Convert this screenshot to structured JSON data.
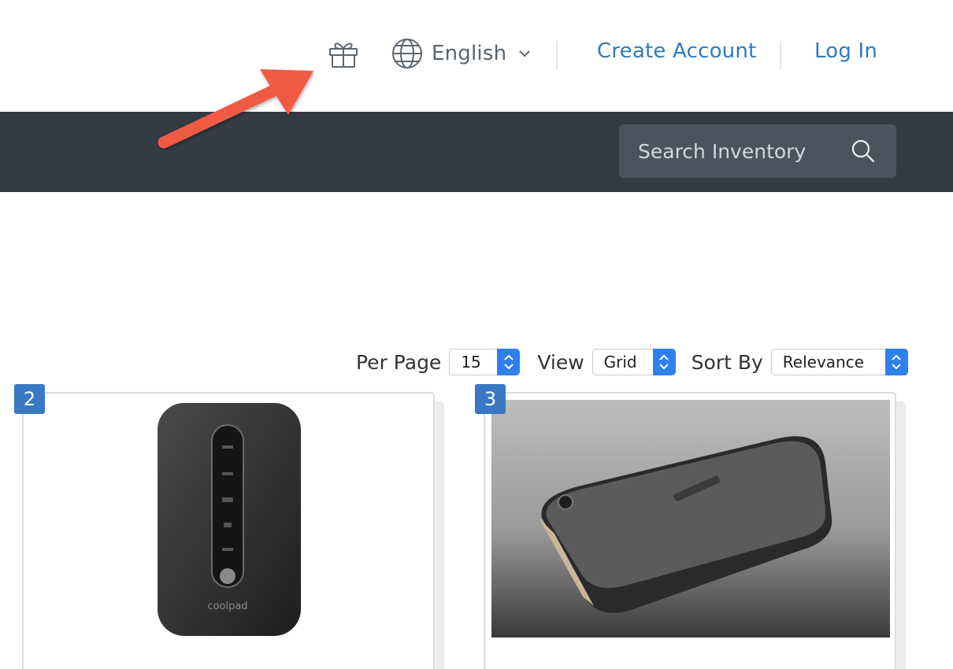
{
  "header": {
    "language_label": "English",
    "create_account_label": "Create Account",
    "login_label": "Log In"
  },
  "search": {
    "placeholder": "Search Inventory"
  },
  "controls": {
    "per_page_label": "Per Page",
    "per_page_value": "15",
    "view_label": "View",
    "view_value": "Grid",
    "sort_label": "Sort By",
    "sort_value": "Relevance"
  },
  "products": [
    {
      "number": "2",
      "image": "portable-hotspot-image",
      "brand_text": "coolpad"
    },
    {
      "number": "3",
      "image": "external-hard-drive-image"
    }
  ],
  "colors": {
    "dark_bar": "#343b44",
    "link_blue": "#2f7bbd",
    "select_blue": "#2f80ed",
    "badge_blue": "#3a78c3",
    "annotation_arrow": "#f05a44"
  }
}
